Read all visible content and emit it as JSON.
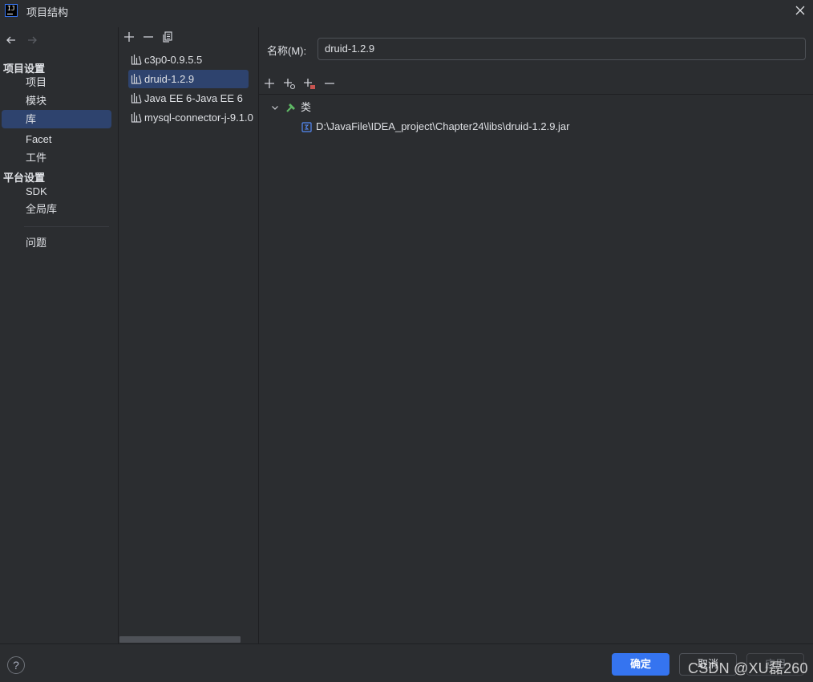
{
  "window": {
    "title": "项目结构"
  },
  "nav": {
    "project_settings_header": "项目设置",
    "platform_settings_header": "平台设置",
    "items": [
      {
        "label": "项目"
      },
      {
        "label": "模块"
      },
      {
        "label": "库"
      },
      {
        "label": "Facet"
      },
      {
        "label": "工件"
      },
      {
        "label": "SDK"
      },
      {
        "label": "全局库"
      },
      {
        "label": "问题"
      }
    ]
  },
  "libraries": {
    "items": [
      {
        "label": "c3p0-0.9.5.5"
      },
      {
        "label": "druid-1.2.9"
      },
      {
        "label": "Java EE 6-Java EE 6"
      },
      {
        "label": "mysql-connector-j-9.1.0"
      }
    ],
    "selected": "druid-1.2.9"
  },
  "detail": {
    "name_label": "名称(M):",
    "name_value": "druid-1.2.9",
    "classes_label": "类",
    "jar_path": "D:\\JavaFile\\IDEA_project\\Chapter24\\libs\\druid-1.2.9.jar"
  },
  "footer": {
    "help": "?",
    "ok_label": "确定",
    "cancel_label": "取消",
    "apply_label": "应用"
  },
  "watermark": "CSDN @XU磊260",
  "colors": {
    "background": "#2b2d30",
    "selection": "#2e436e",
    "accent": "#3574f0",
    "text": "#dfe1e5"
  }
}
